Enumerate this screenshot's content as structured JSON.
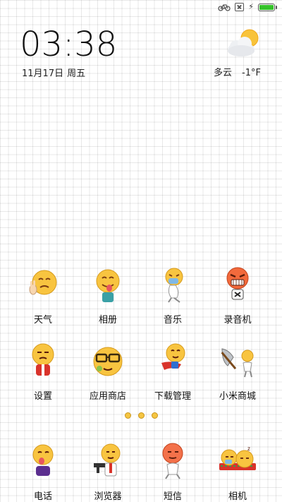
{
  "clock": {
    "time": "03:38",
    "date": "11月17日",
    "weekday": "周五"
  },
  "weather": {
    "condition": "多云",
    "temp": "-1°F",
    "icon": "partly-cloudy-icon"
  },
  "apps": [
    {
      "label": "天气",
      "icon": "emoji-peace-sign-icon"
    },
    {
      "label": "相册",
      "icon": "emoji-tongue-icon"
    },
    {
      "label": "音乐",
      "icon": "emoji-sitting-mask-icon"
    },
    {
      "label": "录音机",
      "icon": "emoji-angry-icon"
    },
    {
      "label": "设置",
      "icon": "emoji-red-shirt-icon"
    },
    {
      "label": "应用商店",
      "icon": "emoji-glasses-icon"
    },
    {
      "label": "下载管理",
      "icon": "emoji-flying-icon"
    },
    {
      "label": "小米商城",
      "icon": "emoji-axe-icon"
    }
  ],
  "dock": [
    {
      "label": "电话",
      "icon": "emoji-tongue-out-icon"
    },
    {
      "label": "浏览器",
      "icon": "emoji-gun-icon"
    },
    {
      "label": "短信",
      "icon": "emoji-red-face-icon"
    },
    {
      "label": "相机",
      "icon": "emoji-sleeping-icon"
    }
  ],
  "status": {
    "battery_color": "#35c22a",
    "icons": [
      "bike-icon",
      "sim-icon",
      "charging-icon",
      "battery-icon"
    ]
  }
}
